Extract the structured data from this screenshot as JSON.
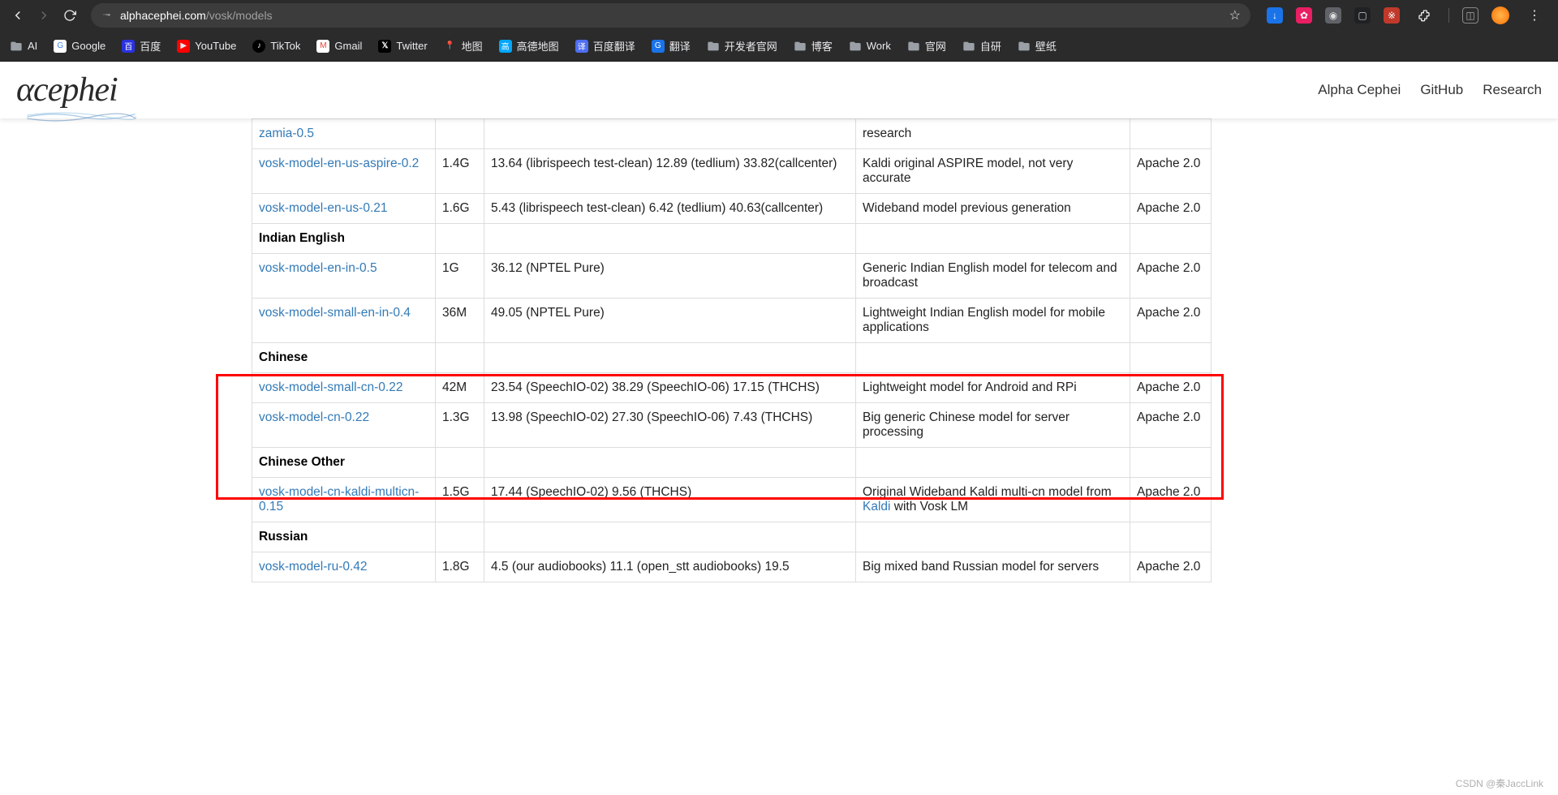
{
  "browser": {
    "url_host": "alphacephei.com",
    "url_path": "/vosk/models",
    "bookmarks": [
      {
        "label": "AI",
        "cls": "folder"
      },
      {
        "label": "Google",
        "cls": "google"
      },
      {
        "label": "百度",
        "cls": "baidu"
      },
      {
        "label": "YouTube",
        "cls": "yt"
      },
      {
        "label": "TikTok",
        "cls": "tiktok"
      },
      {
        "label": "Gmail",
        "cls": "gmail"
      },
      {
        "label": "Twitter",
        "cls": "x"
      },
      {
        "label": "地图",
        "cls": "gmap"
      },
      {
        "label": "高德地图",
        "cls": "amap"
      },
      {
        "label": "百度翻译",
        "cls": "bdtrans"
      },
      {
        "label": "翻译",
        "cls": "gtrans"
      },
      {
        "label": "开发者官网",
        "cls": "folder"
      },
      {
        "label": "博客",
        "cls": "folder"
      },
      {
        "label": "Work",
        "cls": "folder"
      },
      {
        "label": "官网",
        "cls": "folder"
      },
      {
        "label": "自研",
        "cls": "folder"
      },
      {
        "label": "壁纸",
        "cls": "folder"
      }
    ]
  },
  "header": {
    "logo_text": "αcephei",
    "nav": {
      "n0": "Alpha Cephei",
      "n1": "GitHub",
      "n2": "Research"
    }
  },
  "table": {
    "rows": [
      {
        "type": "link",
        "name": "zamia-0.5",
        "size": "",
        "wer": "",
        "notes": "research",
        "lic": ""
      },
      {
        "type": "link",
        "name": "vosk-model-en-us-aspire-0.2",
        "size": "1.4G",
        "wer": "13.64 (librispeech test-clean) 12.89 (tedlium) 33.82(callcenter)",
        "notes": "Kaldi original ASPIRE model, not very accurate",
        "lic": "Apache 2.0"
      },
      {
        "type": "link",
        "name": "vosk-model-en-us-0.21",
        "size": "1.6G",
        "wer": "5.43 (librispeech test-clean) 6.42 (tedlium) 40.63(callcenter)",
        "notes": "Wideband model previous generation",
        "lic": "Apache 2.0"
      },
      {
        "type": "header",
        "name": "Indian English"
      },
      {
        "type": "link",
        "name": "vosk-model-en-in-0.5",
        "size": "1G",
        "wer": "36.12 (NPTEL Pure)",
        "notes": "Generic Indian English model for telecom and broadcast",
        "lic": "Apache 2.0"
      },
      {
        "type": "link",
        "name": "vosk-model-small-en-in-0.4",
        "size": "36M",
        "wer": "49.05 (NPTEL Pure)",
        "notes": "Lightweight Indian English model for mobile applications",
        "lic": "Apache 2.0"
      },
      {
        "type": "header",
        "name": "Chinese"
      },
      {
        "type": "link",
        "name": "vosk-model-small-cn-0.22",
        "size": "42M",
        "wer": "23.54 (SpeechIO-02) 38.29 (SpeechIO-06) 17.15 (THCHS)",
        "notes": "Lightweight model for Android and RPi",
        "lic": "Apache 2.0"
      },
      {
        "type": "link",
        "name": "vosk-model-cn-0.22",
        "size": "1.3G",
        "wer": "13.98 (SpeechIO-02) 27.30 (SpeechIO-06) 7.43 (THCHS)",
        "notes": "Big generic Chinese model for server processing",
        "lic": "Apache 2.0"
      },
      {
        "type": "header",
        "name": "Chinese Other"
      },
      {
        "type": "link",
        "name": "vosk-model-cn-kaldi-multicn-0.15",
        "size": "1.5G",
        "wer": "17.44 (SpeechIO-02) 9.56 (THCHS)",
        "notes": "Original Wideband Kaldi multi-cn model from ",
        "notes_link": "Kaldi",
        "notes_suffix": " with Vosk LM",
        "lic": "Apache 2.0"
      },
      {
        "type": "header",
        "name": "Russian"
      },
      {
        "type": "link",
        "name": "vosk-model-ru-0.42",
        "size": "1.8G",
        "wer": "4.5 (our audiobooks) 11.1 (open_stt audiobooks) 19.5",
        "notes": "Big mixed band Russian model for servers",
        "lic": "Apache 2.0"
      }
    ]
  },
  "watermark": "CSDN @秦JaccLink"
}
